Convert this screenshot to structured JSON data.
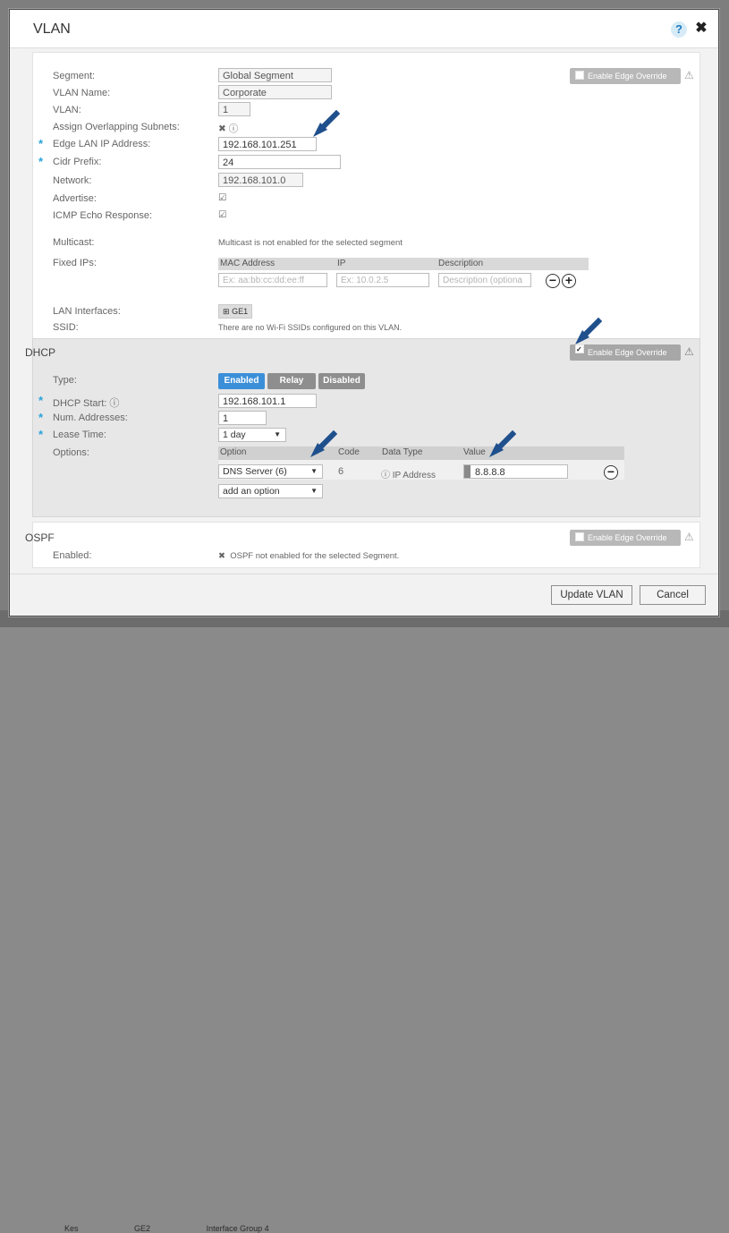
{
  "dialog": {
    "title": "VLAN",
    "help_label": "?",
    "close_label": "✖"
  },
  "vlan": {
    "segment_label": "Segment:",
    "segment_value": "Global Segment",
    "name_label": "VLAN Name:",
    "name_value": "Corporate",
    "vlan_label": "VLAN:",
    "vlan_value": "1",
    "overlap_label": "Assign Overlapping Subnets:",
    "edge_ip_label": "Edge LAN IP Address:",
    "edge_ip_value": "192.168.101.251",
    "cidr_label": "Cidr Prefix:",
    "cidr_value": "24",
    "network_label": "Network:",
    "network_value": "192.168.101.0",
    "advertise_label": "Advertise:",
    "icmp_label": "ICMP Echo Response:",
    "multicast_label": "Multicast:",
    "multicast_value": "Multicast is not enabled for the selected segment",
    "fixed_ips_label": "Fixed IPs:",
    "fixed_cols": [
      "MAC Address",
      "IP",
      "Description"
    ],
    "fixed_placeholders": [
      "Ex: aa:bb:cc:dd:ee:ff",
      "Ex: 10.0.2.5",
      "Description (optiona"
    ],
    "lan_label": "LAN Interfaces:",
    "lan_chip": "GE1",
    "ssid_label": "SSID:",
    "ssid_value": "There are no Wi-Fi SSIDs configured on this VLAN.",
    "override_label": "Enable Edge Override"
  },
  "dhcp": {
    "title": "DHCP",
    "override_label": "Enable Edge Override",
    "type_label": "Type:",
    "type_options": [
      "Enabled",
      "Relay",
      "Disabled"
    ],
    "start_label": "DHCP Start:",
    "start_value": "192.168.101.1",
    "num_label": "Num. Addresses:",
    "num_value": "1",
    "lease_label": "Lease Time:",
    "lease_value": "1 day",
    "options_label": "Options:",
    "options_cols": [
      "Option",
      "Code",
      "Data Type",
      "Value"
    ],
    "option_row": {
      "option": "DNS Server (6)",
      "code": "6",
      "type": "IP Address",
      "value": "8.8.8.8"
    },
    "add_option": "add an option"
  },
  "ospf": {
    "title": "OSPF",
    "override_label": "Enable Edge Override",
    "enabled_label": "Enabled:",
    "enabled_value": "OSPF not enabled for the selected Segment."
  },
  "footer": {
    "update_label": "Update VLAN",
    "cancel_label": "Cancel"
  },
  "backdrop": {
    "row": [
      "Kes",
      "GE2",
      "Interface Group 4"
    ]
  },
  "colors": {
    "accent": "#3b8fd9",
    "required": "#2aa3dc",
    "arrow": "#1f4f8c"
  }
}
